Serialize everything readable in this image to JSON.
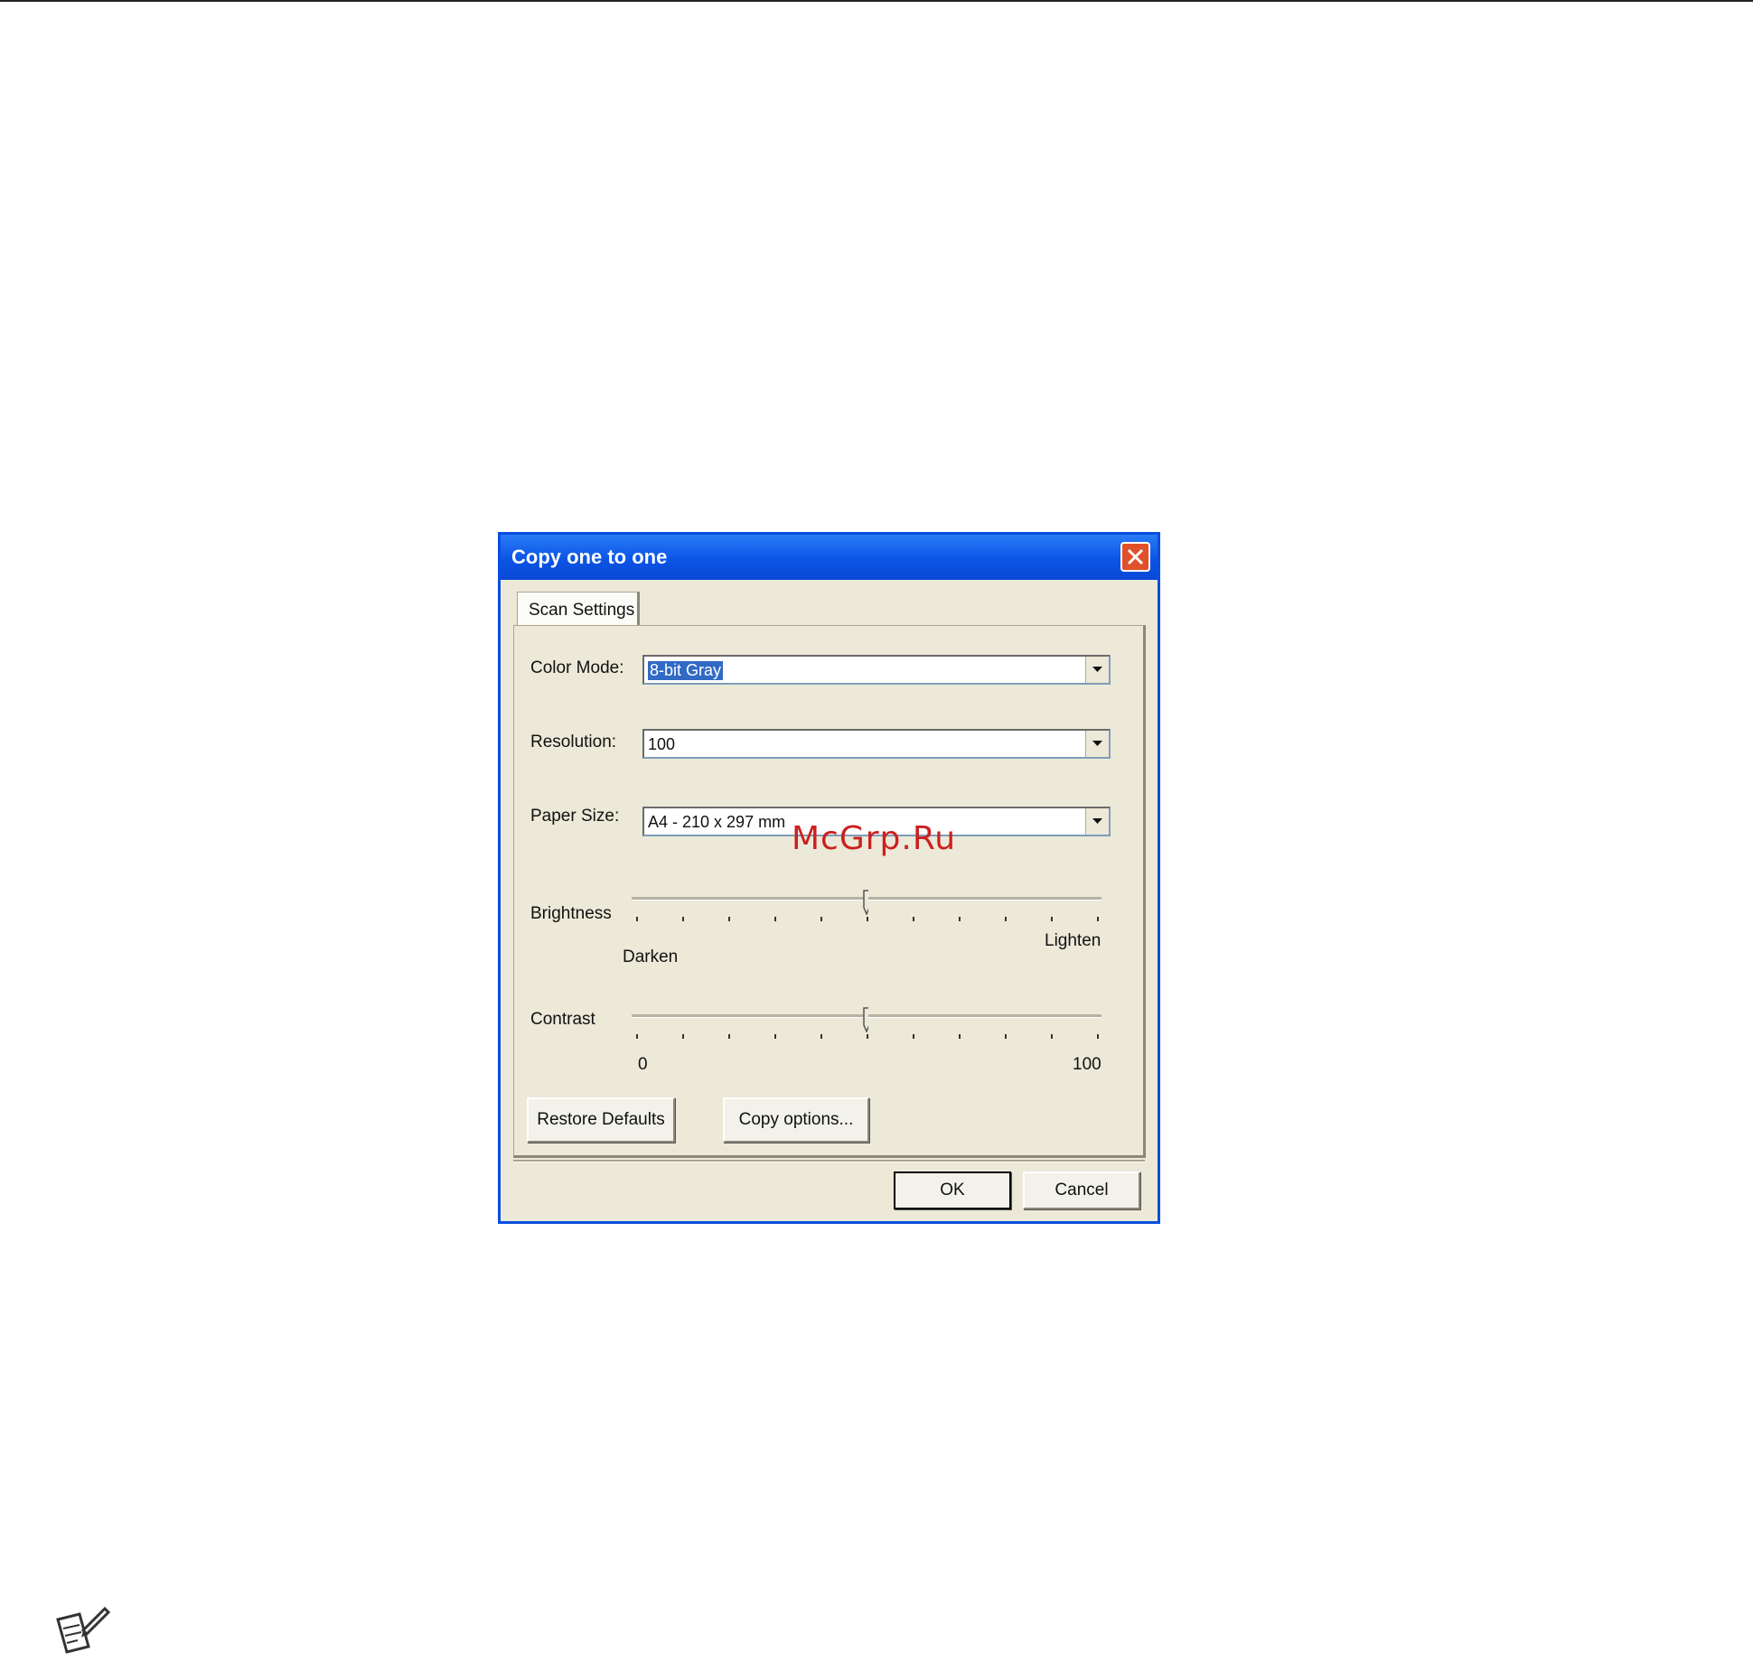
{
  "dialog": {
    "title": "Copy one to one",
    "tab_label": "Scan Settings",
    "color_mode": {
      "label": "Color Mode:",
      "value": "8-bit Gray"
    },
    "resolution": {
      "label": "Resolution:",
      "value": "100"
    },
    "paper_size": {
      "label": "Paper Size:",
      "value": "A4 - 210 x 297 mm"
    },
    "brightness": {
      "label": "Brightness",
      "min_label": "Darken",
      "max_label": "Lighten",
      "level": 0.5
    },
    "contrast": {
      "label": "Contrast",
      "min_label": "0",
      "max_label": "100",
      "level": 0.5
    },
    "restore_defaults_label": "Restore Defaults",
    "copy_options_label": "Copy options...",
    "ok_label": "OK",
    "cancel_label": "Cancel"
  },
  "watermark": "McGrp.Ru",
  "colors": {
    "titlebar": "#0b55e6",
    "dialog_bg": "#ece9d8",
    "selection": "#316ac5",
    "close": "#e0502a"
  },
  "icons": [
    "close-icon",
    "dropdown-arrow-icon",
    "note-pencil-icon"
  ]
}
